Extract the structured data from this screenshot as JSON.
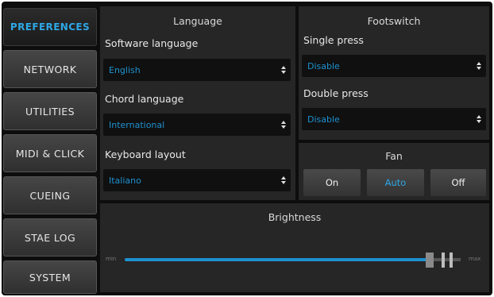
{
  "menu": {
    "items": [
      {
        "label": "PREFERENCES",
        "active": true
      },
      {
        "label": "NETWORK",
        "active": false
      },
      {
        "label": "UTILITIES",
        "active": false
      },
      {
        "label": "MIDI & CLICK",
        "active": false
      },
      {
        "label": "CUEING",
        "active": false
      },
      {
        "label": "STAE LOG",
        "active": false
      },
      {
        "label": "SYSTEM",
        "active": false
      }
    ]
  },
  "language": {
    "title": "Language",
    "software": {
      "label": "Software language",
      "value": "English"
    },
    "chord": {
      "label": "Chord language",
      "value": "International"
    },
    "keyboard": {
      "label": "Keyboard layout",
      "value": "Italiano"
    }
  },
  "footswitch": {
    "title": "Footswitch",
    "single": {
      "label": "Single press",
      "value": "Disable"
    },
    "double": {
      "label": "Double press",
      "value": "Disable"
    }
  },
  "fan": {
    "title": "Fan",
    "options": [
      "On",
      "Auto",
      "Off"
    ],
    "selected": "Auto"
  },
  "brightness": {
    "title": "Brightness",
    "min_label": "min",
    "max_label": "max",
    "level": 0.92
  },
  "colors": {
    "accent": "#2ea7e6",
    "panel": "#262626",
    "background": "#0d0d0d"
  }
}
